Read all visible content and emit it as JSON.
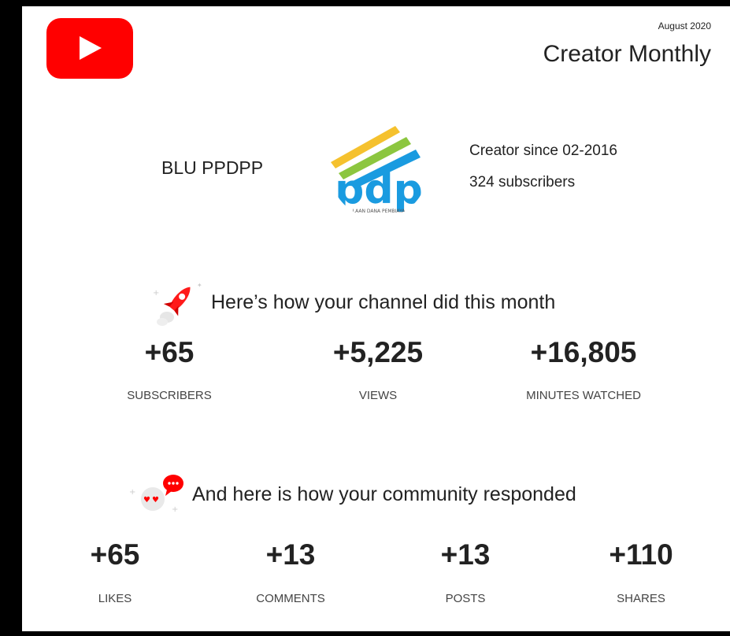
{
  "header": {
    "date": "August 2020",
    "title": "Creator Monthly"
  },
  "icons": {
    "youtube": "youtube-play-icon",
    "rocket": "rocket-icon",
    "community": "heart-eyes-chat-icon",
    "channel_logo": "pdp-logo"
  },
  "channel": {
    "name": "BLU PPDPP",
    "logo_text": "pdp",
    "logo_small_text": "LAAN DANA PEMBIAYA",
    "creator_since": "Creator since 02-2016",
    "subscribers": "324 subscribers"
  },
  "channel_section": {
    "heading": "Here’s how your channel did this month",
    "stats": [
      {
        "value": "+65",
        "label": "SUBSCRIBERS"
      },
      {
        "value": "+5,225",
        "label": "VIEWS"
      },
      {
        "value": "+16,805",
        "label": "MINUTES WATCHED"
      }
    ]
  },
  "community_section": {
    "heading": "And here is how your community responded",
    "stats": [
      {
        "value": "+65",
        "label": "LIKES"
      },
      {
        "value": "+13",
        "label": "COMMENTS"
      },
      {
        "value": "+13",
        "label": "POSTS"
      },
      {
        "value": "+110",
        "label": "SHARES"
      }
    ]
  },
  "colors": {
    "youtube_red": "#ff0000",
    "pdp_blue": "#1a9be0",
    "pdp_yellow": "#f5c12e",
    "pdp_green": "#8cc63f"
  }
}
